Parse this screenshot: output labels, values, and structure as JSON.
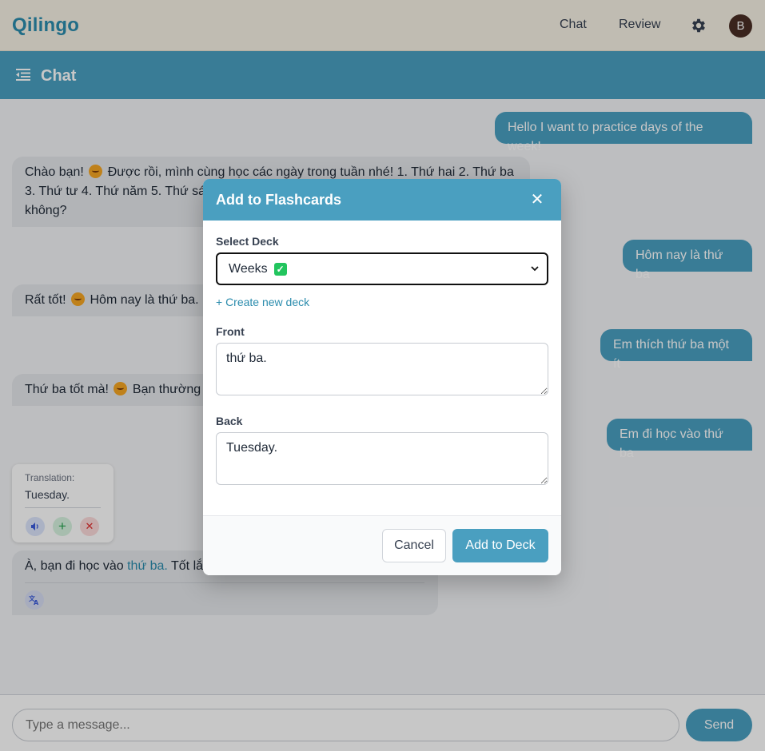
{
  "app": {
    "brand": "Qilingo"
  },
  "nav": {
    "chat": "Chat",
    "review": "Review",
    "avatar_initial": "B"
  },
  "subheader": {
    "title": "Chat"
  },
  "messages": {
    "user1": "Hello I want to practice days of the week!",
    "bot1": [
      "Chào bạn!",
      "Được rồi, mình cùng học các ngày trong tuần nhé! 1. Thứ hai 2. Thứ ba",
      "3. Thứ tư 4. Thứ năm 5. Thứ sáu",
      "không?"
    ],
    "user2": "Hôm nay là thứ ba",
    "bot2": [
      "Rất tốt!",
      "Hôm nay là thứ ba."
    ],
    "user3": "Em thích thứ ba một ít",
    "bot3": [
      "Thứ ba tốt mà!",
      "Bạn thường"
    ],
    "user4": "Em đi học vào thứ ba",
    "bot4": {
      "before": "À, bạn đi học vào ",
      "highlight": "thứ ba.",
      "after": " Tốt lắ"
    }
  },
  "translation_card": {
    "label": "Translation:",
    "text": "Tuesday."
  },
  "composer": {
    "placeholder": "Type a message...",
    "send_label": "Send"
  },
  "modal": {
    "title": "Add to Flashcards",
    "deck_label": "Select Deck",
    "deck_selected": "Weeks",
    "create_deck_link": "+ Create new deck",
    "front_label": "Front",
    "front_value": "thứ ba.",
    "back_label": "Back",
    "back_value": "Tuesday.",
    "cancel_label": "Cancel",
    "submit_label": "Add to Deck"
  }
}
